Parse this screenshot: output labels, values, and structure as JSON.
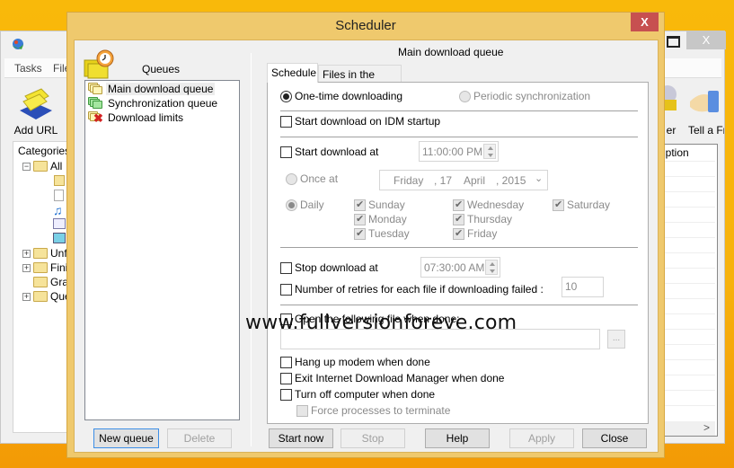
{
  "background_app": {
    "menu": [
      "Tasks",
      "File"
    ],
    "toolbar": {
      "add_url": "Add URL",
      "scheduler_partial": "er",
      "tell_friend": "Tell a Fr"
    },
    "categories_title": "Categories",
    "tree": [
      {
        "label": "All",
        "expander": "−"
      },
      {
        "label": "Unf",
        "expander": "+"
      },
      {
        "label": "Fini",
        "expander": "+"
      },
      {
        "label": "Gra",
        "expander": ""
      },
      {
        "label": "Que",
        "expander": "+"
      }
    ],
    "filelist_header": "iption",
    "close_glyph": "X"
  },
  "dialog": {
    "title": "Scheduler",
    "close_glyph": "X",
    "queues_title": "Queues",
    "queues": [
      {
        "label": "Main download queue",
        "icon": "queue-folder-yellow-icon",
        "selected": true
      },
      {
        "label": "Synchronization queue",
        "icon": "queue-folder-green-icon",
        "selected": false
      },
      {
        "label": "Download limits",
        "icon": "queue-folder-limit-icon",
        "selected": false
      }
    ],
    "new_queue": "New queue",
    "delete": "Delete",
    "queue_heading": "Main download queue",
    "tabs": {
      "schedule": "Schedule",
      "files": "Files in the queue"
    },
    "schedule": {
      "one_time": "One-time downloading",
      "periodic": "Periodic synchronization",
      "start_on_startup": "Start download on IDM startup",
      "start_at": "Start download at",
      "start_time": "11:00:00 PM",
      "once_at": "Once at",
      "date": {
        "weekday": "Friday",
        "day": ", 17",
        "month": "April",
        "year": ", 2015"
      },
      "daily": "Daily",
      "days": [
        {
          "label": "Sunday",
          "checked": true
        },
        {
          "label": "Monday",
          "checked": true
        },
        {
          "label": "Tuesday",
          "checked": true
        },
        {
          "label": "Wednesday",
          "checked": true
        },
        {
          "label": "Thursday",
          "checked": true
        },
        {
          "label": "Friday",
          "checked": true
        },
        {
          "label": "Saturday",
          "checked": true
        }
      ],
      "stop_at": "Stop download at",
      "stop_time": "07:30:00 AM",
      "retries_label": "Number of retries for each file if downloading failed :",
      "retries_value": "10",
      "open_file": "Open the following file when done:",
      "open_file_value": "",
      "browse": "...",
      "hang_up": "Hang up modem when done",
      "exit_idm": "Exit Internet Download Manager when done",
      "turn_off": "Turn off computer when done",
      "force_terminate": "Force processes to terminate"
    },
    "buttons": {
      "start_now": "Start now",
      "stop": "Stop",
      "help": "Help",
      "apply": "Apply",
      "close": "Close"
    }
  },
  "watermark": "www.fullversionforeve.com"
}
